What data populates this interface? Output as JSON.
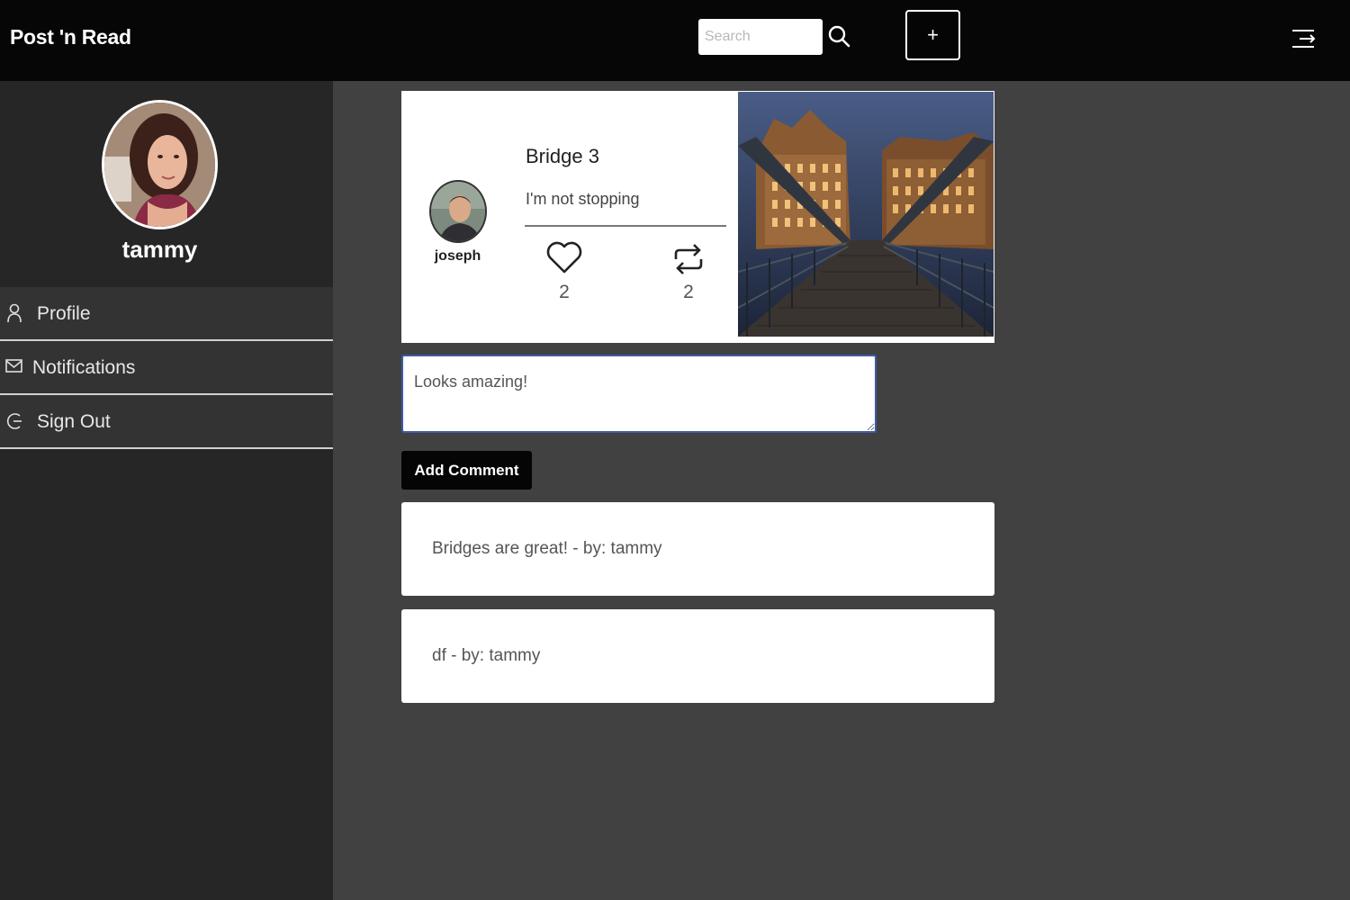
{
  "header": {
    "brand": "Post 'n Read",
    "search_placeholder": "Search",
    "add_label": "+"
  },
  "sidebar": {
    "username": "tammy",
    "nav": [
      {
        "label": "Profile",
        "icon": "user-icon"
      },
      {
        "label": "Notifications",
        "icon": "mail-icon"
      },
      {
        "label": "Sign Out",
        "icon": "sign-out-icon"
      }
    ]
  },
  "post": {
    "author": "joseph",
    "title": "Bridge 3",
    "body": "I'm not stopping",
    "likes": "2",
    "reposts": "2",
    "image": "bridge-photo"
  },
  "comment_form": {
    "value": "Looks amazing!",
    "button_label": "Add Comment"
  },
  "comments": [
    {
      "text": "Bridges are great! - by: tammy"
    },
    {
      "text": "df - by: tammy"
    }
  ],
  "colors": {
    "topbar": "#070607",
    "sidebar": "#262626",
    "nav_item": "#333333",
    "content_bg": "#414141",
    "input_border": "#3c5ba8"
  }
}
